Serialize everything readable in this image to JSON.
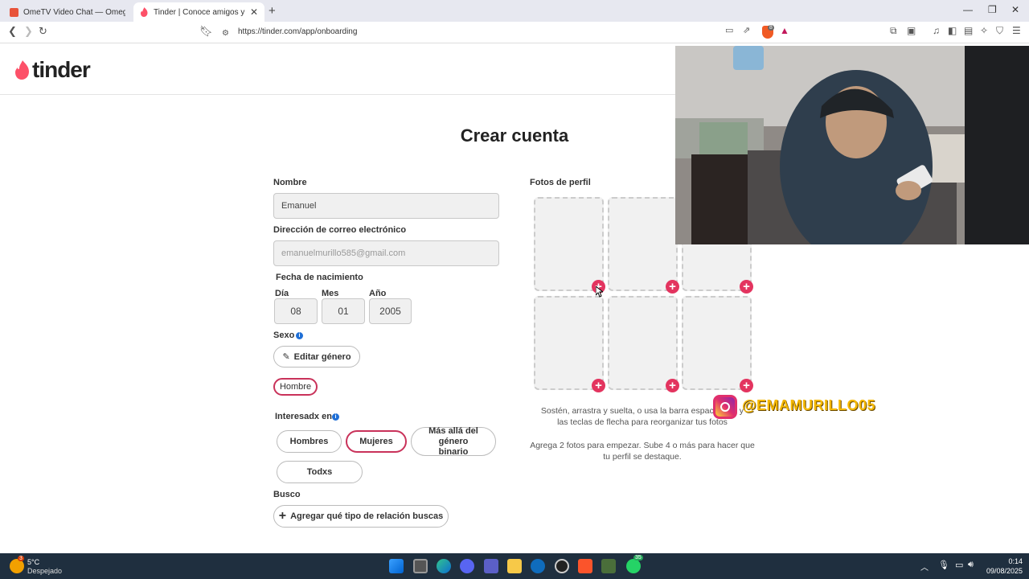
{
  "browser": {
    "tabs": [
      {
        "label": "OmeTV Video Chat — Omegle Rand",
        "active": false
      },
      {
        "label": "Tinder | Conoce amigos y gente",
        "active": true
      }
    ],
    "url": "https://tinder.com/app/onboarding",
    "shield_badge": "8"
  },
  "page": {
    "logo": "tinder",
    "title": "Crear cuenta",
    "name_label": "Nombre",
    "name_value": "Emanuel",
    "email_label": "Dirección de correo electrónico",
    "email_value": "emanuelmurillo585@gmail.com",
    "birth_label": "Fecha de nacimiento",
    "day_label": "Día",
    "month_label": "Mes",
    "year_label": "Año",
    "day_value": "08",
    "month_value": "01",
    "year_value": "2005",
    "sex_label": "Sexo",
    "edit_gender": "Editar género",
    "gender_selected": "Hombre",
    "interested_label": "Interesadx en",
    "interest_options": [
      "Hombres",
      "Mujeres",
      "Más allá del género binario",
      "Todxs"
    ],
    "interest_selected": "Mujeres",
    "seeking_label": "Busco",
    "seeking_button": "Agregar qué tipo de relación buscas",
    "photos_label": "Fotos de perfil",
    "photos_hint1": "Sostén, arrastra y suelta, o usa la barra espaciadora y las teclas de flecha para reorganizar tus fotos",
    "photos_hint2": "Agrega 2 fotos para empezar. Sube 4 o más para hacer que tu perfil se destaque."
  },
  "overlay": {
    "instagram_handle": "@EMAMURILLO05"
  },
  "taskbar": {
    "weather_temp": "5°C",
    "weather_desc": "Despejado",
    "weather_badge": "3",
    "whatsapp_badge": "35",
    "time": "0:14",
    "date": "09/08/2025"
  },
  "colors": {
    "tinder_red": "#fd5068",
    "accent_pink": "#e3345f",
    "taskbar": "#1f2f3f"
  }
}
